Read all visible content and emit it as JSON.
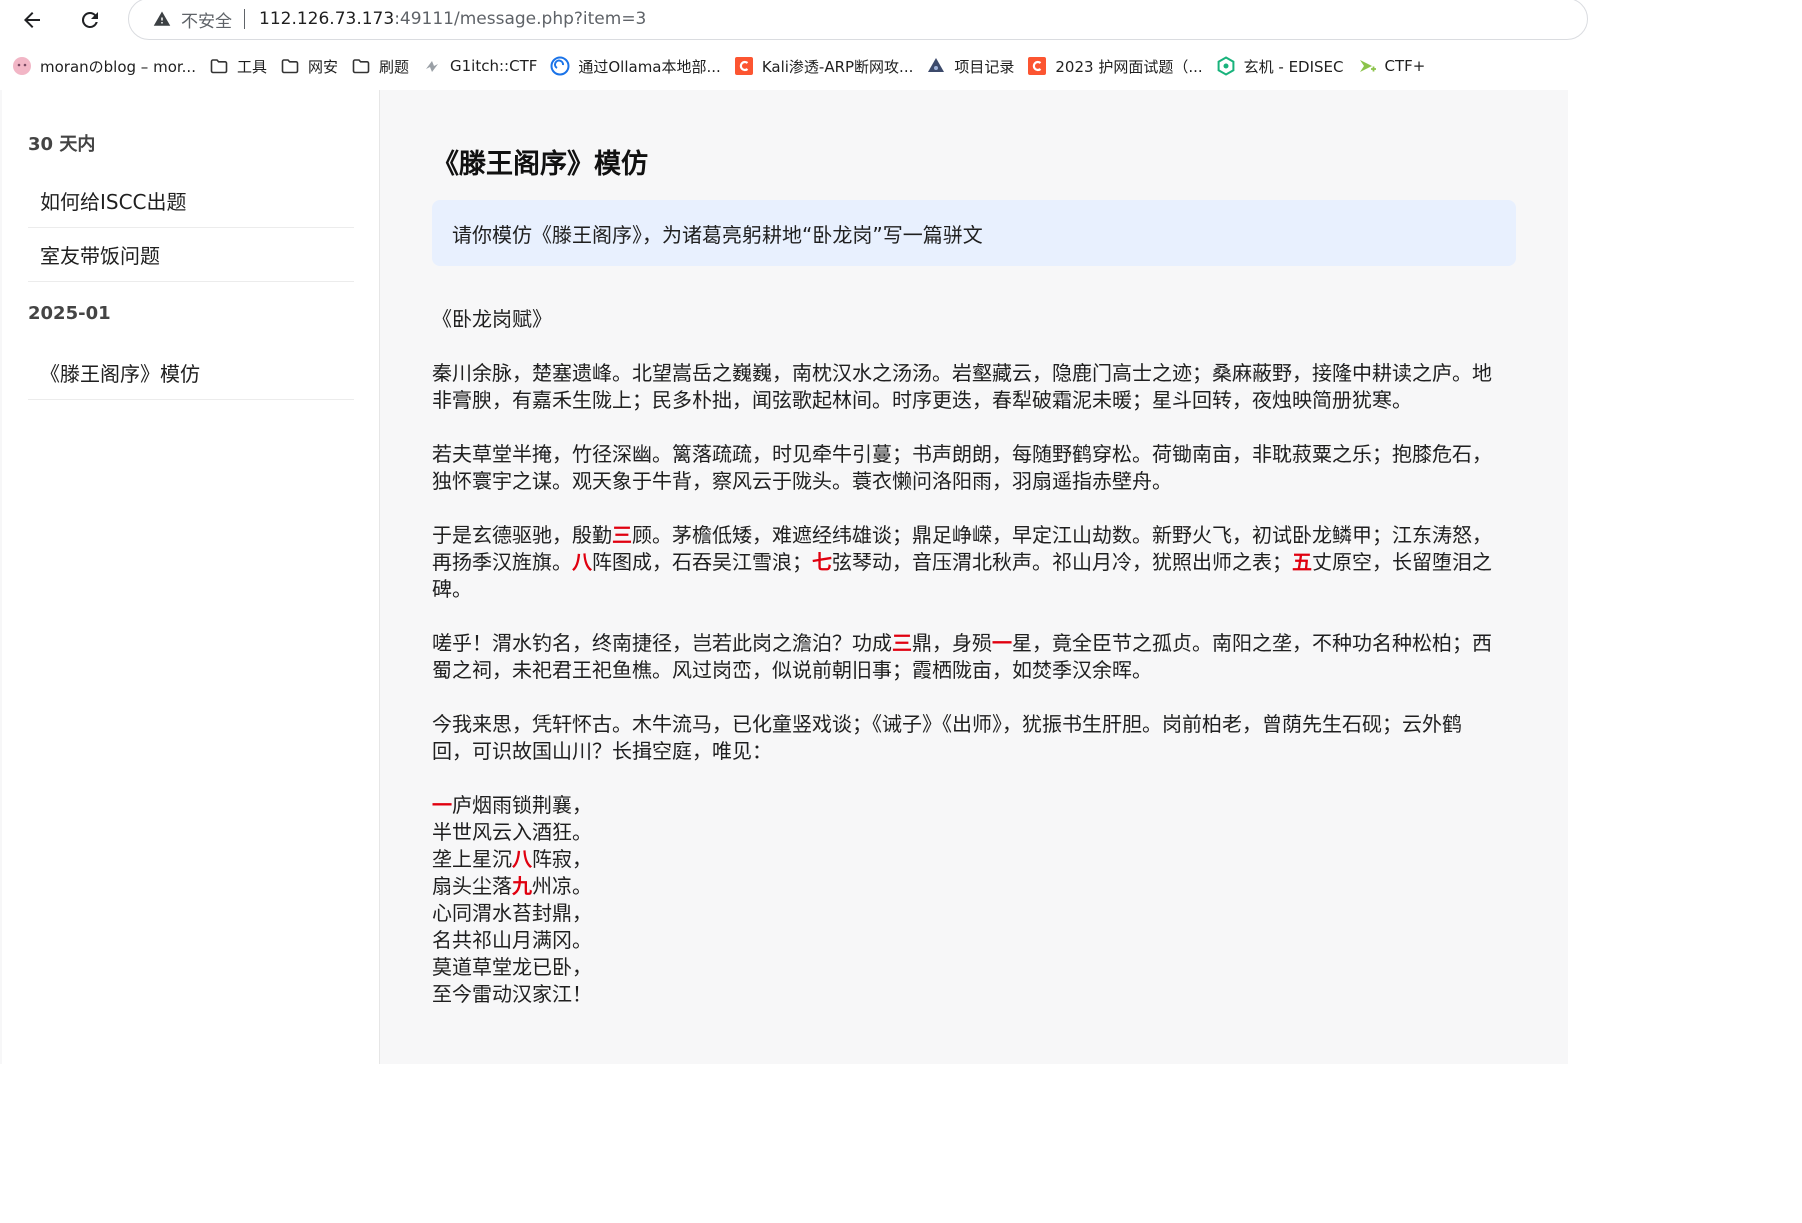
{
  "browser": {
    "security_label": "不安全",
    "url_host": "112.126.73.173",
    "url_rest": ":49111/message.php?item=3"
  },
  "bookmarks": [
    {
      "label": "moranのblog – mor...",
      "icon": "anime-avatar-icon",
      "color": "#f2b6c6"
    },
    {
      "label": "工具",
      "icon": "folder-icon",
      "color": "#333333"
    },
    {
      "label": "网安",
      "icon": "folder-icon",
      "color": "#333333"
    },
    {
      "label": "刷题",
      "icon": "folder-icon",
      "color": "#333333"
    },
    {
      "label": "G1itch::CTF",
      "icon": "glitch-site-icon",
      "color": "#9aa0a6"
    },
    {
      "label": "通过Ollama本地部...",
      "icon": "ollama-site-icon",
      "color": "#1a73e8"
    },
    {
      "label": "Kali渗透-ARP断网攻...",
      "icon": "csdn-icon",
      "color": "#fc5531"
    },
    {
      "label": "项目记录",
      "icon": "project-site-icon",
      "color": "#3c4a6b"
    },
    {
      "label": "2023 护网面试题（...",
      "icon": "csdn-icon",
      "color": "#fc5531"
    },
    {
      "label": "玄机 - EDISEC",
      "icon": "hexagon-site-icon",
      "color": "#19b37c"
    },
    {
      "label": "CTF+",
      "icon": "ctfplus-site-icon",
      "color": "#8bc34a"
    }
  ],
  "sidebar": {
    "groups": [
      {
        "label": "30 天内",
        "items": [
          "如何给ISCC出题",
          "室友带饭问题"
        ]
      },
      {
        "label": "2025-01",
        "items": [
          "《滕王阁序》模仿"
        ]
      }
    ]
  },
  "conversation": {
    "title": "《滕王阁序》模仿",
    "user_message": "请你模仿《滕王阁序》，为诸葛亮躬耕地“卧龙岗”写一篇骈文",
    "answer_title": "《卧龙岗赋》",
    "paragraphs": [
      [
        {
          "t": "秦川余脉，楚塞遗峰。北望嵩岳之巍巍，南枕汉水之汤汤。岩壑藏云，隐鹿门高士之迹；桑麻蔽野，接隆中耕读之庐。地非膏腴，有嘉禾生陇上；民多朴拙，闻弦歌起林间。时序更迭，春犁破霜泥未暖；星斗回转，夜烛映简册犹寒。"
        }
      ],
      [
        {
          "t": "若夫草堂半掩，竹径深幽。篱落疏疏，时见牵牛引蔓；书声朗朗，每随野鹤穿松。荷锄南亩，非耽菽粟之乐；抱膝危石，独怀寰宇之谋。观天象于牛背，察风云于陇头。蓑衣懒问洛阳雨，羽扇遥指赤壁舟。"
        }
      ],
      [
        {
          "t": "于是玄德驱驰，殷勤"
        },
        {
          "t": "三",
          "hl": true
        },
        {
          "t": "顾。茅檐低矮，难遮经纬雄谈；鼎足峥嵘，早定江山劫数。新野火飞，初试卧龙鳞甲；江东涛怒，再扬季汉旌旗。"
        },
        {
          "t": "八",
          "hl": true
        },
        {
          "t": "阵图成，石吞吴江雪浪；"
        },
        {
          "t": "七",
          "hl": true
        },
        {
          "t": "弦琴动，音压渭北秋声。祁山月冷，犹照出师之表；"
        },
        {
          "t": "五",
          "hl": true
        },
        {
          "t": "丈原空，长留堕泪之碑。"
        }
      ],
      [
        {
          "t": "嗟乎！渭水钓名，终南捷径，岂若此岗之澹泊？功成"
        },
        {
          "t": "三",
          "hl": true
        },
        {
          "t": "鼎，身殒"
        },
        {
          "t": "一",
          "hl": true
        },
        {
          "t": "星，竟全臣节之孤贞。南阳之垄，不种功名种松柏；西蜀之祠，未祀君王祀鱼樵。风过岗峦，似说前朝旧事；霞栖陇亩，如焚季汉余晖。"
        }
      ],
      [
        {
          "t": "今我来思，凭轩怀古。木牛流马，已化童竖戏谈；《诫子》《出师》，犹振书生肝胆。岗前柏老，曾荫先生石砚；云外鹤回，可识故国山川？长揖空庭，唯见："
        }
      ]
    ],
    "poem": [
      [
        {
          "t": "一",
          "hl": true
        },
        {
          "t": "庐烟雨锁荆襄，"
        }
      ],
      [
        {
          "t": "半世风云入酒狂。"
        }
      ],
      [
        {
          "t": "垄上星沉"
        },
        {
          "t": "八",
          "hl": true
        },
        {
          "t": "阵寂，"
        }
      ],
      [
        {
          "t": "扇头尘落"
        },
        {
          "t": "九",
          "hl": true
        },
        {
          "t": "州凉。"
        }
      ],
      [
        {
          "t": "心同渭水苔封鼎，"
        }
      ],
      [
        {
          "t": "名共祁山月满冈。"
        }
      ],
      [
        {
          "t": "莫道草堂龙已卧，"
        }
      ],
      [
        {
          "t": "至今雷动汉家江！"
        }
      ]
    ],
    "highlight_color": "#e0000f"
  }
}
